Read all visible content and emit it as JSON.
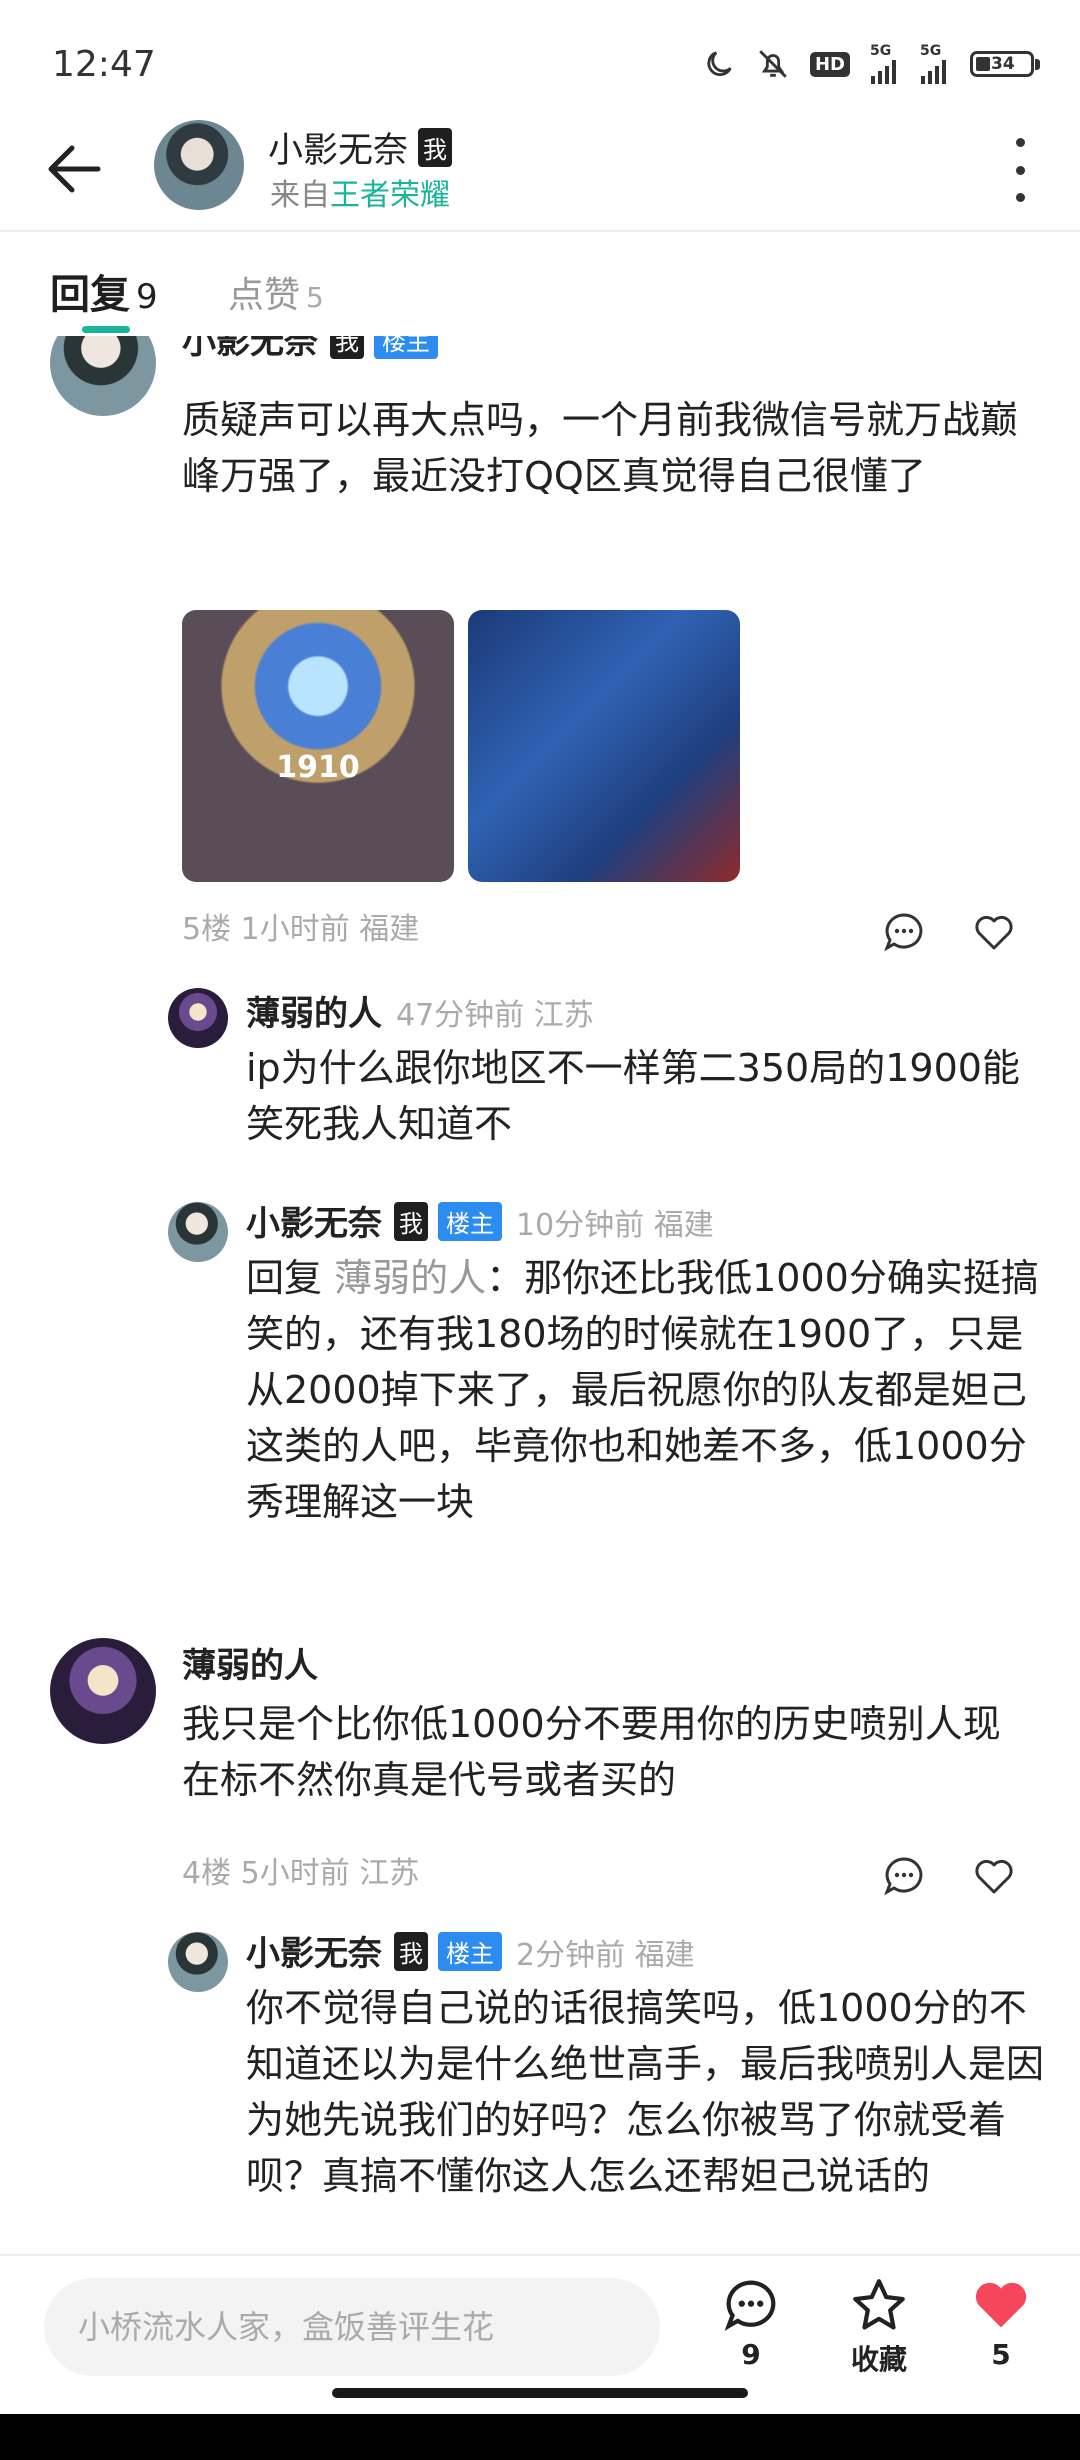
{
  "status_bar": {
    "time": "12:47",
    "hd_label": "HD",
    "net1": "5G",
    "net2": "5G",
    "battery": "34"
  },
  "header": {
    "user_name": "小影无奈",
    "me_badge": "我",
    "source_prefix": "来自",
    "source_link": "王者荣耀"
  },
  "tabs": {
    "reply_label": "回复",
    "reply_count": "9",
    "like_label": "点赞",
    "like_count": "5"
  },
  "posts": [
    {
      "author": "小影无奈",
      "me_tag": "我",
      "op_tag": "楼主",
      "text": "质疑声可以再大点吗，一个月前我微信号就万战巅峰万强了，最近没打QQ区真觉得自己很懂了",
      "image_score": "1910",
      "meta": "5楼  1小时前  福建",
      "replies": [
        {
          "author": "薄弱的人",
          "meta": "47分钟前  江苏",
          "text": "ip为什么跟你地区不一样第二350局的1900能笑死我人知道不"
        },
        {
          "author": "小影无奈",
          "me_tag": "我",
          "op_tag": "楼主",
          "meta": "10分钟前  福建",
          "reply_prefix": "回复 ",
          "reply_target": "薄弱的人",
          "reply_sep": "：",
          "text": "那你还比我低1000分确实挺搞笑的，还有我180场的时候就在1900了，只是从2000掉下来了，最后祝愿你的队友都是妲己这类的人吧，毕竟你也和她差不多，低1000分秀理解这一块"
        }
      ]
    },
    {
      "author": "薄弱的人",
      "text": "我只是个比你低1000分不要用你的历史喷别人现在标不然你真是代号或者买的",
      "meta": "4楼  5小时前  江苏",
      "replies": [
        {
          "author": "小影无奈",
          "me_tag": "我",
          "op_tag": "楼主",
          "meta": "2分钟前  福建",
          "text": "你不觉得自己说的话很搞笑吗，低1000分的不知道还以为是什么绝世高手，最后我喷别人是因为她先说我们的好吗？怎么你被骂了你就受着呗？真搞不懂你这人怎么还帮妲己说话的"
        }
      ]
    }
  ],
  "bottom_bar": {
    "input_placeholder": "小桥流水人家，盒饭善评生花",
    "comment_count": "9",
    "favorite_label": "收藏",
    "like_count": "5"
  },
  "icons": [
    "back-arrow-icon",
    "more-vertical-icon",
    "comment-icon",
    "heart-icon",
    "star-icon",
    "moon-icon",
    "bell-off-icon"
  ],
  "colors": {
    "accent": "#19b49a",
    "op_tag": "#2d8cf0",
    "like": "#f5465a"
  }
}
